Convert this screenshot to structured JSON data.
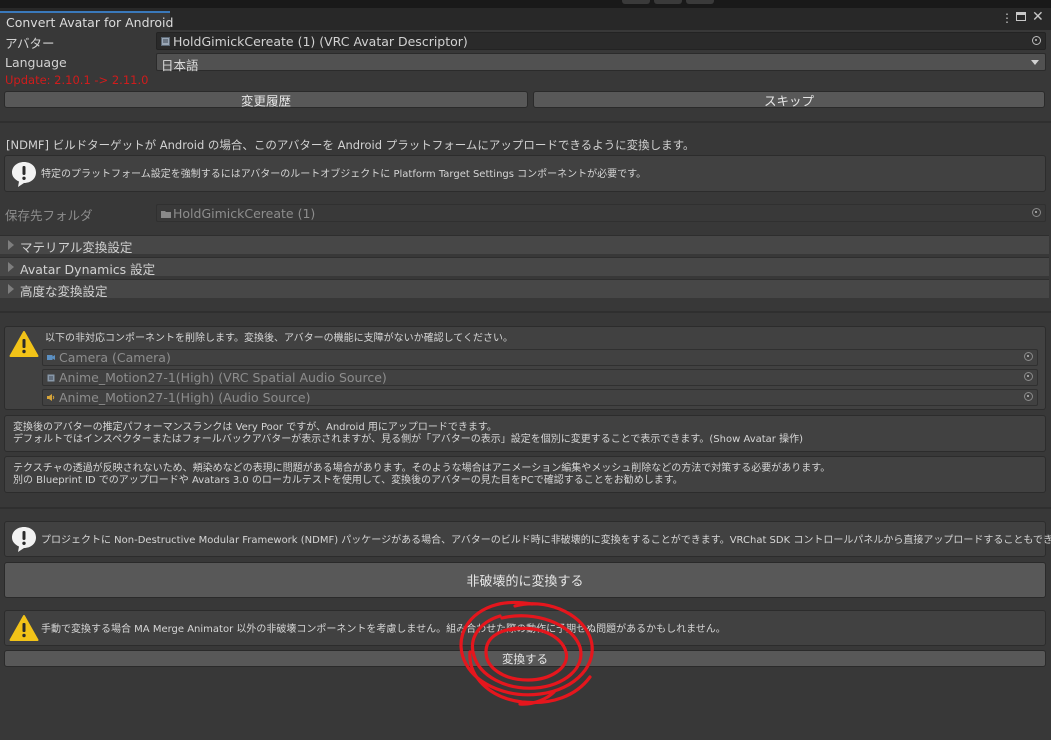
{
  "window": {
    "title": "Convert Avatar for Android"
  },
  "avatar": {
    "label": "アバター",
    "value": "HoldGimickCereate (1) (VRC Avatar Descriptor)"
  },
  "language": {
    "label": "Language",
    "value": "日本語"
  },
  "update_notice": "Update: 2.10.1 -> 2.11.0",
  "history_button": "変更履歴",
  "skip_button": "スキップ",
  "intro_text": "[NDMF] ビルドターゲットが Android の場合、このアバターを Android プラットフォームにアップロードできるように変換します。",
  "platform_info": "特定のプラットフォーム設定を強制するにはアバターのルートオブジェクトに Platform Target Settings コンポーネントが必要です。",
  "save_folder": {
    "label": "保存先フォルダ",
    "value": "HoldGimickCereate (1)"
  },
  "foldouts": [
    "マテリアル変換設定",
    "Avatar Dynamics 設定",
    "高度な変換設定"
  ],
  "unsupported": {
    "message": "以下の非対応コンポーネントを削除します。変換後、アバターの機能に支障がないか確認してください。",
    "components": [
      {
        "name": "Camera (Camera)",
        "icon": "camera-icon"
      },
      {
        "name": "Anime_Motion27-1(High) (VRC Spatial Audio Source)",
        "icon": "script-icon"
      },
      {
        "name": "Anime_Motion27-1(High) (Audio Source)",
        "icon": "audio-source-icon"
      }
    ]
  },
  "performance": {
    "line1": "変換後のアバターの推定パフォーマンスランクは Very Poor ですが、Android 用にアップロードできます。",
    "line2": "デフォルトではインスペクターまたはフォールバックアバターが表示されますが、見る側が「アバターの表示」設定を個別に変更することで表示できます。(Show Avatar 操作)"
  },
  "texture": {
    "line1": "テクスチャの透過が反映されないため、頬染めなどの表現に問題がある場合があります。そのような場合はアニメーション編集やメッシュ削除などの方法で対策する必要があります。",
    "line2": "別の Blueprint ID でのアップロードや Avatars 3.0 のローカルテストを使用して、変換後のアバターの見た目をPCで確認することをお勧めします。"
  },
  "ndmf_info": "プロジェクトに Non-Destructive Modular Framework (NDMF) パッケージがある場合、アバターのビルド時に非破壊的に変換をすることができます。VRChat SDK コントロールパネルから直接アップロードすることもできます。",
  "nondestructive_button": "非破壊的に変換する",
  "manual_warning": "手動で変換する場合 MA Merge Animator 以外の非破壊コンポーネントを考慮しません。組み合わせた際の動作に予期せぬ問題があるかもしれません。",
  "convert_button": "変換する",
  "colors": {
    "background": "#383838",
    "update_text": "#d01c1c",
    "annotation": "#e5161d",
    "warning": "#f2c318"
  }
}
